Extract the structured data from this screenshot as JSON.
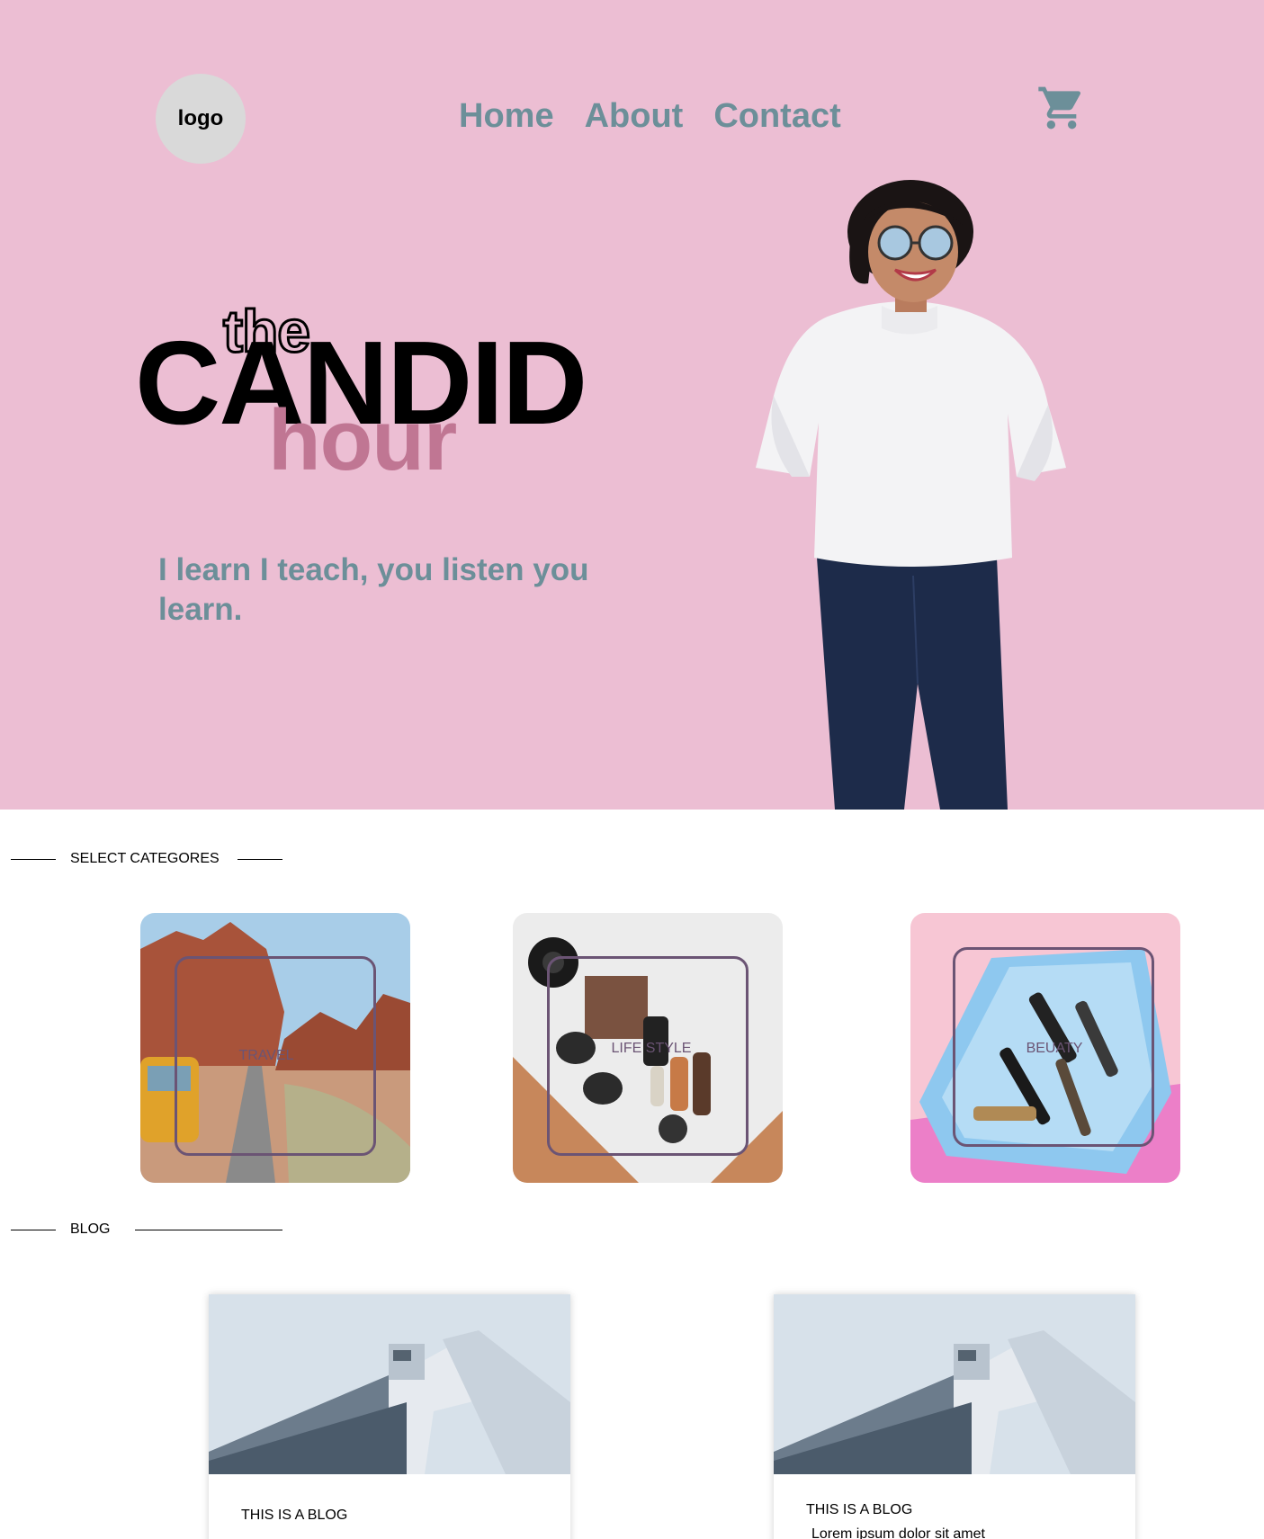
{
  "header": {
    "logo_text": "logo",
    "nav": [
      {
        "label": "Home"
      },
      {
        "label": "About"
      },
      {
        "label": "Contact"
      }
    ],
    "cart_icon": "shopping-cart-icon"
  },
  "hero": {
    "title_the": "the",
    "title_candid": "CANDID",
    "title_hour": "hour",
    "tagline": "I learn I teach, you listen you learn.",
    "background_color": "#ecbed3",
    "accent_color": "#6c8f99",
    "hour_color": "#c07693"
  },
  "categories": {
    "section_label": "SELECT CATEGORES",
    "items": [
      {
        "label": "TRAVEL"
      },
      {
        "label": "LIFE STYLE"
      },
      {
        "label": "BEUATY"
      }
    ]
  },
  "blog": {
    "section_label": "BLOG",
    "posts": [
      {
        "title": "THIS IS A BLOG",
        "excerpt": ""
      },
      {
        "title": "THIS IS A BLOG",
        "excerpt": "Lorem ipsum dolor sit amet"
      }
    ]
  }
}
